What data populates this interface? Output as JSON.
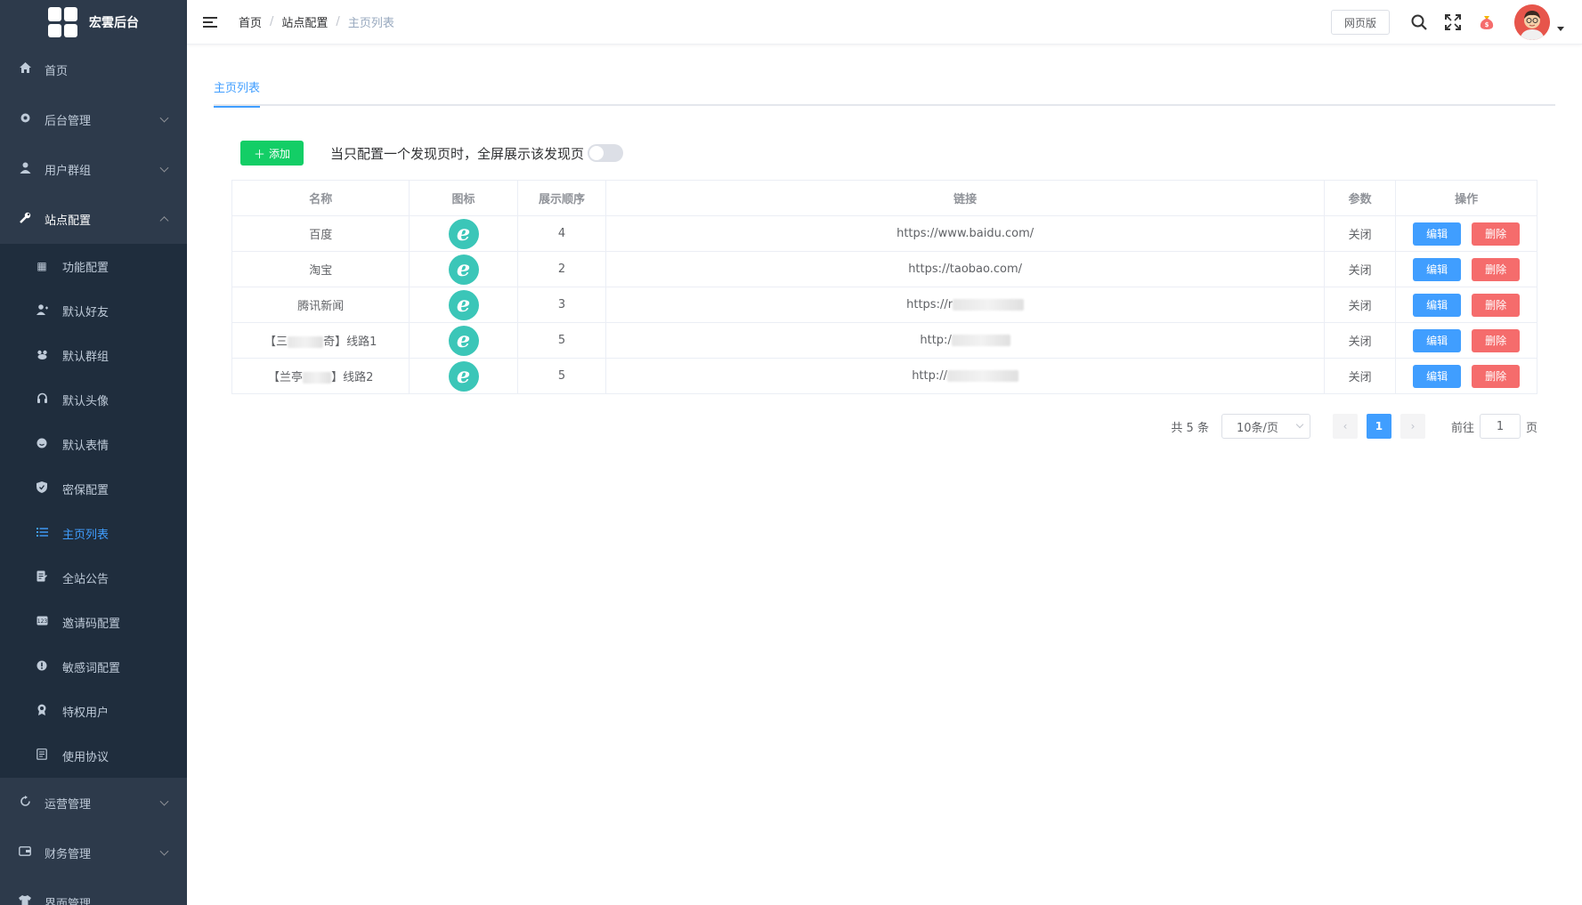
{
  "sidebar": {
    "logo_text": "宏雲后台",
    "menu": [
      {
        "label": "首页",
        "icon": "home-icon"
      },
      {
        "label": "后台管理",
        "icon": "gear-icon"
      },
      {
        "label": "用户群组",
        "icon": "user-icon"
      },
      {
        "label": "站点配置",
        "icon": "wrench-icon"
      }
    ],
    "submenu": [
      {
        "label": "功能配置",
        "icon": "grid-icon"
      },
      {
        "label": "默认好友",
        "icon": "user-add-icon"
      },
      {
        "label": "默认群组",
        "icon": "group-icon"
      },
      {
        "label": "默认头像",
        "icon": "headset-icon"
      },
      {
        "label": "默认表情",
        "icon": "smile-icon"
      },
      {
        "label": "密保配置",
        "icon": "shield-icon"
      },
      {
        "label": "主页列表",
        "icon": "list-icon"
      },
      {
        "label": "全站公告",
        "icon": "notice-icon"
      },
      {
        "label": "邀请码配置",
        "icon": "code-icon"
      },
      {
        "label": "敏感词配置",
        "icon": "warning-icon"
      },
      {
        "label": "特权用户",
        "icon": "vip-icon"
      },
      {
        "label": "使用协议",
        "icon": "document-icon"
      }
    ],
    "bottom_menu": [
      {
        "label": "运营管理",
        "icon": "refresh-icon"
      },
      {
        "label": "财务管理",
        "icon": "wallet-icon"
      },
      {
        "label": "界面管理",
        "icon": "shirt-icon"
      }
    ]
  },
  "header": {
    "breadcrumb": [
      "首页",
      "站点配置",
      "主页列表"
    ],
    "web_version_label": "网页版"
  },
  "main": {
    "tab_label": "主页列表",
    "add_label": "添加",
    "switch_label": "当只配置一个发现页时，全屏展示该发现页",
    "columns": [
      "名称",
      "图标",
      "展示顺序",
      "链接",
      "参数",
      "操作"
    ],
    "rows": [
      {
        "name": "百度",
        "order": "4",
        "link": "https://www.baidu.com/",
        "param": "关闭"
      },
      {
        "name": "淘宝",
        "order": "2",
        "link": "https://taobao.com/",
        "param": "关闭"
      },
      {
        "name": "腾讯新闻",
        "order": "3",
        "link": "https://r",
        "param": "关闭"
      },
      {
        "name_pre": "【三",
        "name_post": "奇】线路1",
        "order": "5",
        "link": "http:/",
        "param": "关闭"
      },
      {
        "name_pre": "【兰亭",
        "name_post": "】线路2",
        "order": "5",
        "link": "http://",
        "param": "关闭"
      }
    ],
    "edit_label": "编辑",
    "delete_label": "删除",
    "icon_glyph": "e"
  },
  "pagination": {
    "total_text": "共 5 条",
    "page_size": "10条/页",
    "current_page": "1",
    "goto_label": "前往",
    "goto_value": "1",
    "page_suffix": "页"
  },
  "colors": {
    "sidebar_bg": "#2d3a4b",
    "submenu_bg": "#1f2d3d",
    "accent": "#409eff",
    "success": "#13ce66",
    "danger": "#f56c6c"
  }
}
